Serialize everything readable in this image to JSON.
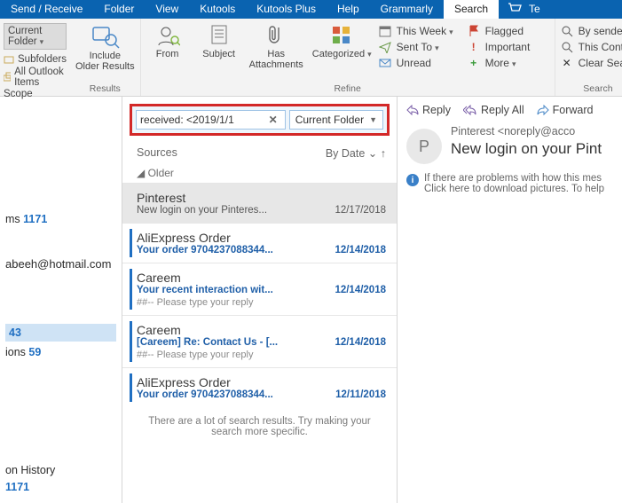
{
  "menubar": {
    "items": [
      "Send / Receive",
      "Folder",
      "View",
      "Kutools",
      "Kutools Plus",
      "Help",
      "Grammarly",
      "Search",
      "Te"
    ]
  },
  "scope_panel": {
    "current_folder": "Current Folder",
    "subfolders": "Subfolders",
    "all_items": "All Outlook Items",
    "caption": "Scope"
  },
  "ribbon": {
    "results": {
      "include_older": "Include\nOlder Results",
      "caption": "Results"
    },
    "refine": {
      "from": "From",
      "subject": "Subject",
      "has_att": "Has\nAttachments",
      "categorized": "Categorized",
      "this_week": "This Week",
      "sent_to": "Sent To",
      "unread": "Unread",
      "flagged": "Flagged",
      "important": "Important",
      "more": "More",
      "caption": "Refine"
    },
    "search": {
      "by_sender": "By sender",
      "this_conta": "This Conta",
      "clear": "Clear Searc",
      "caption": "Search"
    }
  },
  "searchbar": {
    "query": "received: <2019/1/1",
    "scope": "Current Folder"
  },
  "list_header": {
    "sources": "Sources",
    "bydate": "By Date"
  },
  "older_label": "Older",
  "messages": [
    {
      "from": "Pinterest",
      "subject": "New login on your Pinteres...",
      "date": "12/17/2018",
      "extra": ""
    },
    {
      "from": "AliExpress Order",
      "subject": "Your order  9704237088344...",
      "date": "12/14/2018",
      "extra": ""
    },
    {
      "from": "Careem",
      "subject": "Your recent interaction wit...",
      "date": "12/14/2018",
      "extra": "##-- Please type your reply"
    },
    {
      "from": "Careem",
      "subject": "[Careem] Re: Contact Us - [...",
      "date": "12/14/2018",
      "extra": "##-- Please type your reply"
    },
    {
      "from": "AliExpress Order",
      "subject": "Your order 9704237088344...",
      "date": "12/11/2018",
      "extra": ""
    }
  ],
  "footnote": "There are a lot of search results. Try making your search more specific.",
  "nav": {
    "ms": "ms",
    "ms_count": "1171",
    "email": "abeeh@hotmail.com",
    "folder1": "43",
    "folder2_label": "ions",
    "folder2_count": "59",
    "history": "on History",
    "hist_count": "1171"
  },
  "reading": {
    "reply": "Reply",
    "replyall": "Reply All",
    "forward": "Forward",
    "sender": "Pinterest <noreply@acco",
    "title": "New login on your Pint",
    "avatar": "P",
    "info1": "If there are problems with how this mes",
    "info2": "Click here to download pictures. To help"
  }
}
